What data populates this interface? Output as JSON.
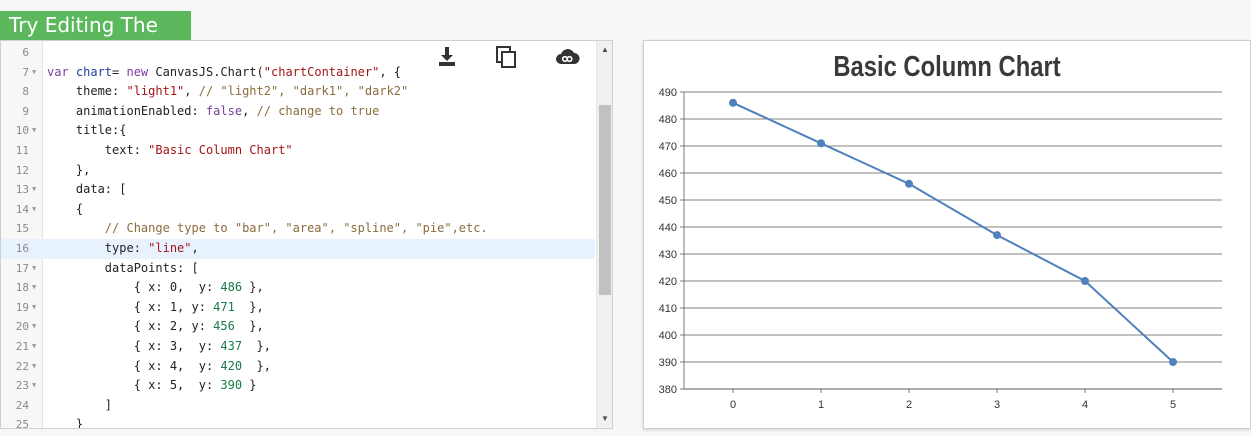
{
  "banner": {
    "label": "Try Editing The Code"
  },
  "editor": {
    "toolbar": [
      {
        "name": "download-icon"
      },
      {
        "name": "copy-icon"
      },
      {
        "name": "share-link-icon"
      }
    ],
    "active_line": 16,
    "lines": [
      {
        "n": "6",
        "fold": false,
        "tokens": []
      },
      {
        "n": "7",
        "fold": true,
        "tokens": [
          [
            "kw",
            "var "
          ],
          [
            "var",
            "chart"
          ],
          [
            "",
            "= "
          ],
          [
            "kw",
            "new "
          ],
          [
            "",
            "CanvasJS.Chart("
          ],
          [
            "str",
            "\"chartContainer\""
          ],
          [
            "",
            ", {"
          ]
        ]
      },
      {
        "n": "8",
        "fold": false,
        "tokens": [
          [
            "",
            "    theme: "
          ],
          [
            "str",
            "\"light1\""
          ],
          [
            "",
            ", "
          ],
          [
            "com",
            "// \"light2\", \"dark1\", \"dark2\""
          ]
        ]
      },
      {
        "n": "9",
        "fold": false,
        "tokens": [
          [
            "",
            "    animationEnabled: "
          ],
          [
            "kw",
            "false"
          ],
          [
            "",
            ", "
          ],
          [
            "com",
            "// change to true"
          ]
        ]
      },
      {
        "n": "10",
        "fold": true,
        "tokens": [
          [
            "",
            "    title:{"
          ]
        ]
      },
      {
        "n": "11",
        "fold": false,
        "tokens": [
          [
            "",
            "        text: "
          ],
          [
            "str",
            "\"Basic Column Chart\""
          ]
        ]
      },
      {
        "n": "12",
        "fold": false,
        "tokens": [
          [
            "",
            "    },"
          ]
        ]
      },
      {
        "n": "13",
        "fold": true,
        "tokens": [
          [
            "",
            "    data: ["
          ]
        ]
      },
      {
        "n": "14",
        "fold": true,
        "tokens": [
          [
            "",
            "    {"
          ]
        ]
      },
      {
        "n": "15",
        "fold": false,
        "tokens": [
          [
            "com",
            "        // Change type to \"bar\", \"area\", \"spline\", \"pie\",etc."
          ]
        ]
      },
      {
        "n": "16",
        "fold": false,
        "tokens": [
          [
            "",
            "        type: "
          ],
          [
            "str",
            "\"line\""
          ],
          [
            "",
            ","
          ]
        ]
      },
      {
        "n": "17",
        "fold": true,
        "tokens": [
          [
            "",
            "        dataPoints: ["
          ]
        ]
      },
      {
        "n": "18",
        "fold": true,
        "tokens": [
          [
            "",
            "            { x: 0,  y: "
          ],
          [
            "num",
            "486"
          ],
          [
            "",
            " },"
          ]
        ]
      },
      {
        "n": "19",
        "fold": true,
        "tokens": [
          [
            "",
            "            { x: 1, y: "
          ],
          [
            "num",
            "471"
          ],
          [
            "",
            "  },"
          ]
        ]
      },
      {
        "n": "20",
        "fold": true,
        "tokens": [
          [
            "",
            "            { x: 2, y: "
          ],
          [
            "num",
            "456"
          ],
          [
            "",
            "  },"
          ]
        ]
      },
      {
        "n": "21",
        "fold": true,
        "tokens": [
          [
            "",
            "            { x: 3,  y: "
          ],
          [
            "num",
            "437"
          ],
          [
            "",
            "  },"
          ]
        ]
      },
      {
        "n": "22",
        "fold": true,
        "tokens": [
          [
            "",
            "            { x: 4,  y: "
          ],
          [
            "num",
            "420"
          ],
          [
            "",
            "  },"
          ]
        ]
      },
      {
        "n": "23",
        "fold": true,
        "tokens": [
          [
            "",
            "            { x: 5,  y: "
          ],
          [
            "num",
            "390"
          ],
          [
            "",
            " }"
          ]
        ]
      },
      {
        "n": "24",
        "fold": false,
        "tokens": [
          [
            "",
            "        ]"
          ]
        ]
      },
      {
        "n": "25",
        "fold": false,
        "tokens": [
          [
            "",
            "    }"
          ]
        ]
      }
    ]
  },
  "chart_data": {
    "type": "line",
    "title": "Basic Column Chart",
    "x": [
      0,
      1,
      2,
      3,
      4,
      5
    ],
    "series": [
      {
        "values": [
          486,
          471,
          456,
          437,
          420,
          390
        ],
        "color": "#4f81bc"
      }
    ],
    "xticks": [
      "0",
      "1",
      "2",
      "3",
      "4",
      "5"
    ],
    "yticks": [
      "380",
      "390",
      "400",
      "410",
      "420",
      "430",
      "440",
      "450",
      "460",
      "470",
      "480",
      "490"
    ],
    "ylim": [
      380,
      490
    ],
    "grid": "horizontal",
    "xlabel": "",
    "ylabel": ""
  }
}
